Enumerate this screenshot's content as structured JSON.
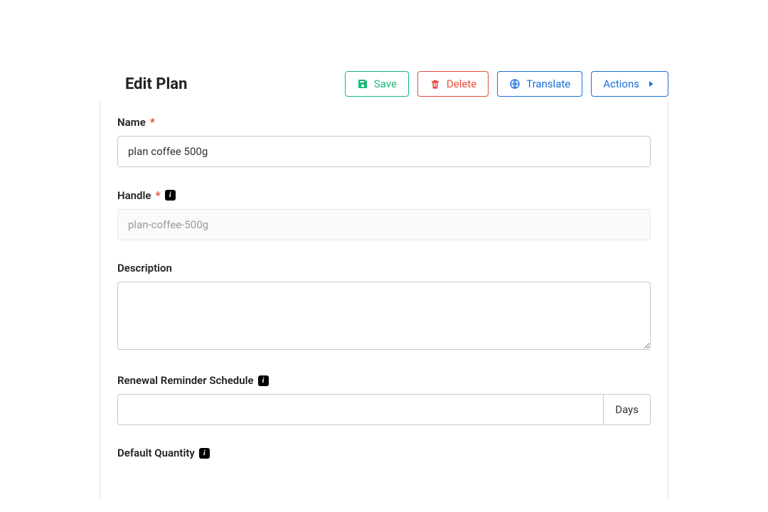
{
  "header": {
    "title": "Edit Plan",
    "buttons": {
      "save": "Save",
      "delete": "Delete",
      "translate": "Translate",
      "actions": "Actions"
    }
  },
  "form": {
    "name": {
      "label": "Name",
      "required": "*",
      "value": "plan coffee 500g"
    },
    "handle": {
      "label": "Handle",
      "required": "*",
      "value": "plan-coffee-500g"
    },
    "description": {
      "label": "Description",
      "value": ""
    },
    "renewal": {
      "label": "Renewal Reminder Schedule",
      "value": "",
      "unit": "Days"
    },
    "default_quantity": {
      "label": "Default Quantity"
    }
  },
  "info_glyph": "i"
}
